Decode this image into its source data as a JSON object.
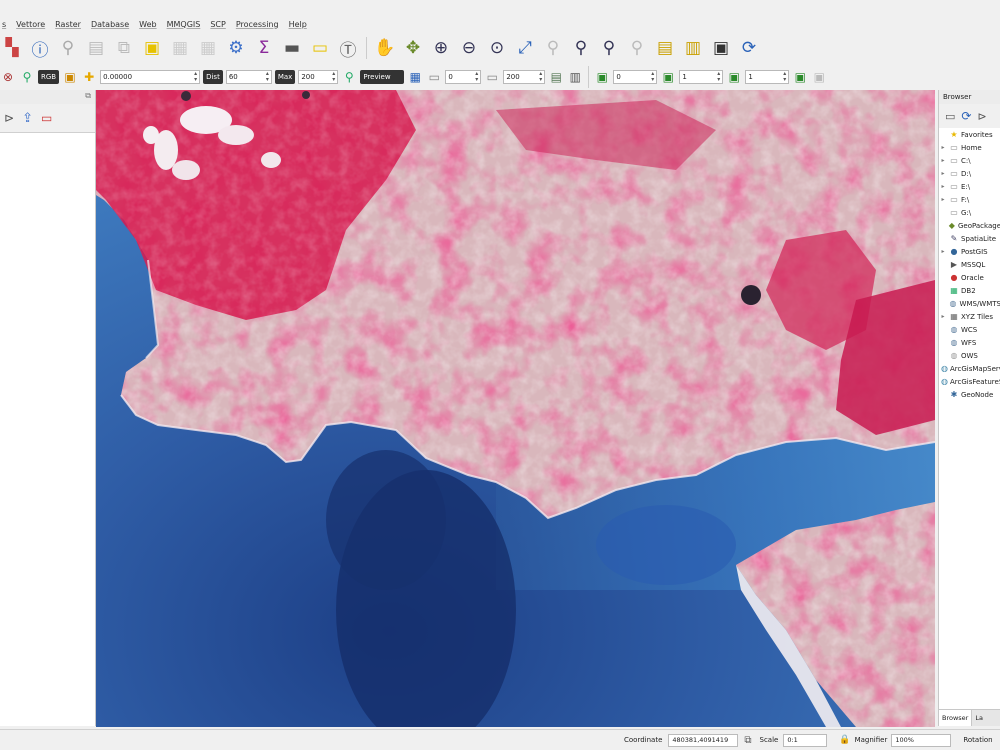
{
  "menubar": {
    "items": [
      "s",
      "Vettore",
      "Raster",
      "Database",
      "Web",
      "MMQGIS",
      "SCP",
      "Processing",
      "Help"
    ]
  },
  "toolbar2": {
    "tag_1": "RGB",
    "field_1": "0.00000",
    "field_2_label": "Dist",
    "field_2": "60",
    "field_3_label": "Max",
    "field_3": "200",
    "tag_2": "Preview",
    "field_4": "0",
    "field_5": "200",
    "field_6": "0",
    "field_7": "1",
    "field_8": "1"
  },
  "browser": {
    "title": "Browser",
    "items": [
      {
        "label": "Favorites",
        "icon": "star-icon",
        "glyph": "★",
        "color": "#e8b800",
        "arrow": ""
      },
      {
        "label": "Home",
        "icon": "folder-icon",
        "glyph": "▭",
        "color": "#888",
        "arrow": "▸"
      },
      {
        "label": "C:\\",
        "icon": "drive-icon",
        "glyph": "▭",
        "color": "#888",
        "arrow": "▸"
      },
      {
        "label": "D:\\",
        "icon": "drive-icon",
        "glyph": "▭",
        "color": "#888",
        "arrow": "▸"
      },
      {
        "label": "E:\\",
        "icon": "drive-icon",
        "glyph": "▭",
        "color": "#888",
        "arrow": "▸"
      },
      {
        "label": "F:\\",
        "icon": "drive-icon",
        "glyph": "▭",
        "color": "#888",
        "arrow": "▸"
      },
      {
        "label": "G:\\",
        "icon": "drive-icon",
        "glyph": "▭",
        "color": "#888",
        "arrow": ""
      },
      {
        "label": "GeoPackage",
        "icon": "geopackage-icon",
        "glyph": "◆",
        "color": "#6a8a2a",
        "arrow": ""
      },
      {
        "label": "SpatiaLite",
        "icon": "spatialite-icon",
        "glyph": "✎",
        "color": "#446",
        "arrow": ""
      },
      {
        "label": "PostGIS",
        "icon": "postgis-icon",
        "glyph": "●",
        "color": "#336699",
        "arrow": "▸"
      },
      {
        "label": "MSSQL",
        "icon": "mssql-icon",
        "glyph": "▶",
        "color": "#555",
        "arrow": ""
      },
      {
        "label": "Oracle",
        "icon": "oracle-icon",
        "glyph": "●",
        "color": "#c33",
        "arrow": ""
      },
      {
        "label": "DB2",
        "icon": "db2-icon",
        "glyph": "▦",
        "color": "#2a6",
        "arrow": ""
      },
      {
        "label": "WMS/WMTS",
        "icon": "wms-icon",
        "glyph": "◍",
        "color": "#579",
        "arrow": ""
      },
      {
        "label": "XYZ Tiles",
        "icon": "xyz-icon",
        "glyph": "▦",
        "color": "#666",
        "arrow": "▸"
      },
      {
        "label": "WCS",
        "icon": "wcs-icon",
        "glyph": "◍",
        "color": "#579",
        "arrow": ""
      },
      {
        "label": "WFS",
        "icon": "wfs-icon",
        "glyph": "◍",
        "color": "#579",
        "arrow": ""
      },
      {
        "label": "OWS",
        "icon": "ows-icon",
        "glyph": "◍",
        "color": "#999",
        "arrow": ""
      },
      {
        "label": "ArcGisMapServer",
        "icon": "arcgis-icon",
        "glyph": "◍",
        "color": "#48a",
        "arrow": ""
      },
      {
        "label": "ArcGisFeatureServer",
        "icon": "arcgis-icon",
        "glyph": "◍",
        "color": "#48a",
        "arrow": ""
      },
      {
        "label": "GeoNode",
        "icon": "geonode-icon",
        "glyph": "✱",
        "color": "#369",
        "arrow": ""
      }
    ],
    "tabs": [
      "Browser",
      "La"
    ]
  },
  "statusbar": {
    "coordinate_label": "Coordinate",
    "coordinate_value": "480381,4091419",
    "scale_label": "Scale",
    "scale_value": "0:1",
    "magnifier_label": "Magnifier",
    "magnifier_value": "100%",
    "rotation_label": "Rotation"
  }
}
